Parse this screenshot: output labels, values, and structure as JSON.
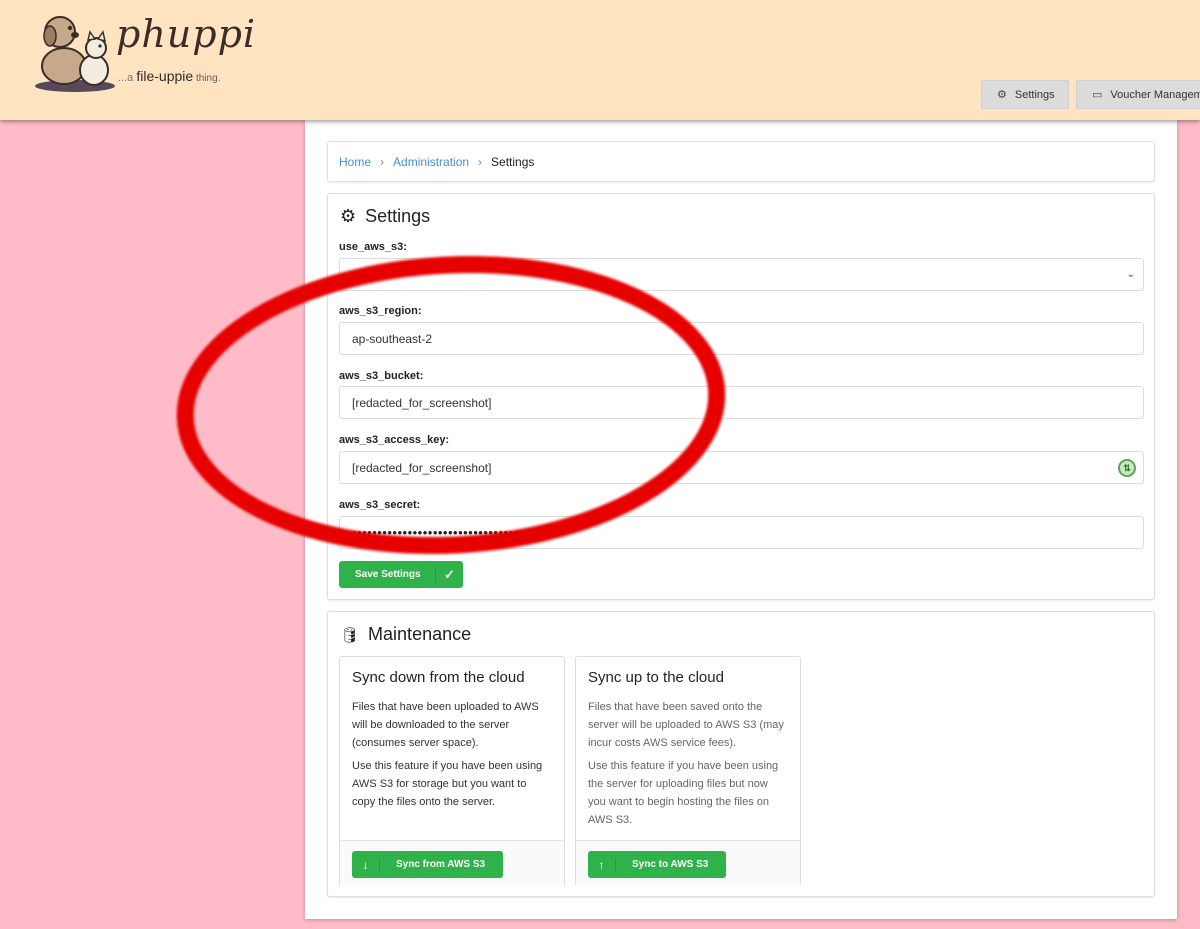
{
  "brand": {
    "name": "phuppi",
    "tagline_prefix": "...a ",
    "tagline_main": "file-uppie",
    "tagline_suffix": " thing."
  },
  "topnav": {
    "settings_label": "Settings",
    "voucher_label": "Voucher Management",
    "settings_icon": "gear-icon",
    "voucher_icon": "ticket-icon"
  },
  "breadcrumb": {
    "home": "Home",
    "admin": "Administration",
    "current": "Settings"
  },
  "settings": {
    "title": "Settings",
    "fields": {
      "use_aws_s3": {
        "label": "use_aws_s3:",
        "value": ""
      },
      "region": {
        "label": "aws_s3_region:",
        "value": "ap-southeast-2"
      },
      "bucket": {
        "label": "aws_s3_bucket:",
        "value": "[redacted_for_screenshot]"
      },
      "access_key": {
        "label": "aws_s3_access_key:",
        "value": "[redacted_for_screenshot]"
      },
      "secret": {
        "label": "aws_s3_secret:",
        "value": "•••••••••••••••••••••••••••••••••••••••"
      }
    },
    "save_label": "Save Settings"
  },
  "maintenance": {
    "title": "Maintenance",
    "down": {
      "title": "Sync down from the cloud",
      "p1": "Files that have been uploaded to AWS will be downloaded to the server (consumes server space).",
      "p2": "Use this feature if you have been using AWS S3 for storage but you want to copy the files onto the server.",
      "button": "Sync from AWS S3"
    },
    "up": {
      "title": "Sync up to the cloud",
      "p1": "Files that have been saved onto the server will be uploaded to AWS S3 (may incur costs AWS service fees).",
      "p2": "Use this feature if you have been using the server for uploading files but now you want to begin hosting the files on AWS S3.",
      "button": "Sync to AWS S3"
    }
  },
  "colors": {
    "page_bg": "#ffbcc8",
    "header_bg": "#ffe4c2",
    "accent_green": "#2fb24a",
    "link_blue": "#4a8fd0",
    "annotation_red": "#e60000"
  }
}
